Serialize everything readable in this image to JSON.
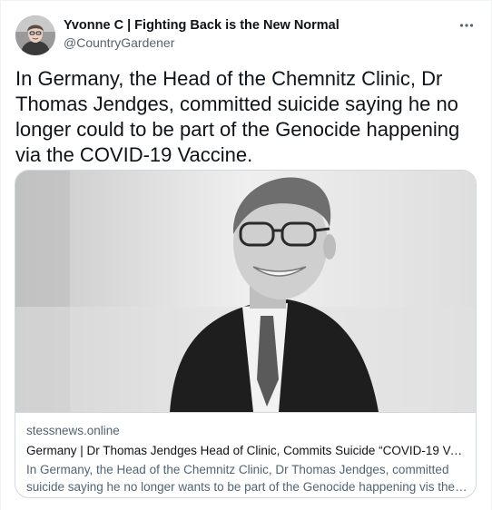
{
  "author": {
    "name": "Yvonne C | Fighting Back is the New Normal",
    "handle": "@CountryGardener",
    "avatar_icon": "user-avatar-photo"
  },
  "more_icon": "more-horizontal-icon",
  "tweet": {
    "text": "In Germany, the Head of the Chemnitz Clinic, Dr Thomas Jendges, committed suicide saying he no longer could to be part of the Genocide happening via the COVID-19 Vaccine."
  },
  "card": {
    "image_icon": "man-portrait-photo",
    "domain": "stessnews.online",
    "title": "Germany | Dr Thomas Jendges Head of Clinic, Commits Suicide “COVID-19 Vac...",
    "description_line1": "In Germany, the Head of the Chemnitz Clinic, Dr Thomas Jendges, committed",
    "description_line2": "suicide saying he no longer wants to be part of the Genocide happening vis the ..."
  },
  "colors": {
    "text_primary": "#0f1419",
    "text_secondary": "#536471",
    "border": "#cfd9de"
  }
}
